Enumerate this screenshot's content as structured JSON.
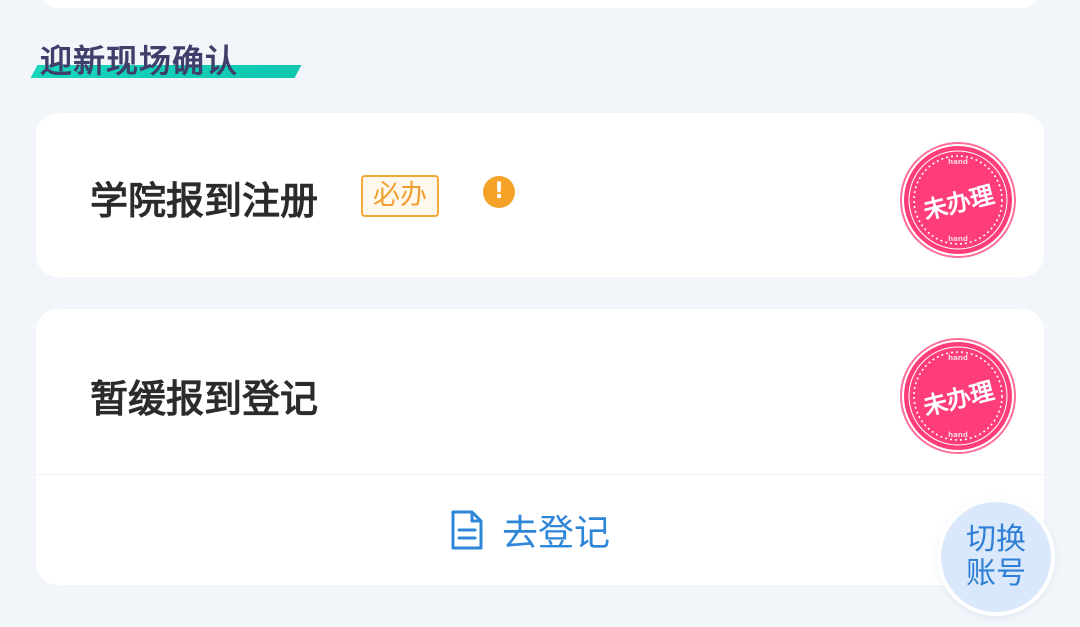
{
  "section": {
    "title": "迎新现场确认"
  },
  "items": [
    {
      "title": "学院报到注册",
      "badge": "必办",
      "warning_icon": "exclamation-circle-icon",
      "status": "未办理",
      "status_stamp_small_text": "hand"
    },
    {
      "title": "暂缓报到登记",
      "status": "未办理",
      "status_stamp_small_text": "hand",
      "action": {
        "label": "去登记",
        "icon": "document-icon"
      }
    }
  ],
  "floating_button": {
    "line1": "切换",
    "line2": "账号"
  },
  "colors": {
    "page_bg": "#f2f5fa",
    "card_bg": "#ffffff",
    "title_color": "#3f3f6b",
    "title_underline": "#18d5bd",
    "badge_orange": "#f0a033",
    "warning_orange": "#f5a229",
    "stamp_pink": "#ff3d7a",
    "link_blue": "#2d86d8",
    "floating_bg": "#d9e8fb"
  }
}
